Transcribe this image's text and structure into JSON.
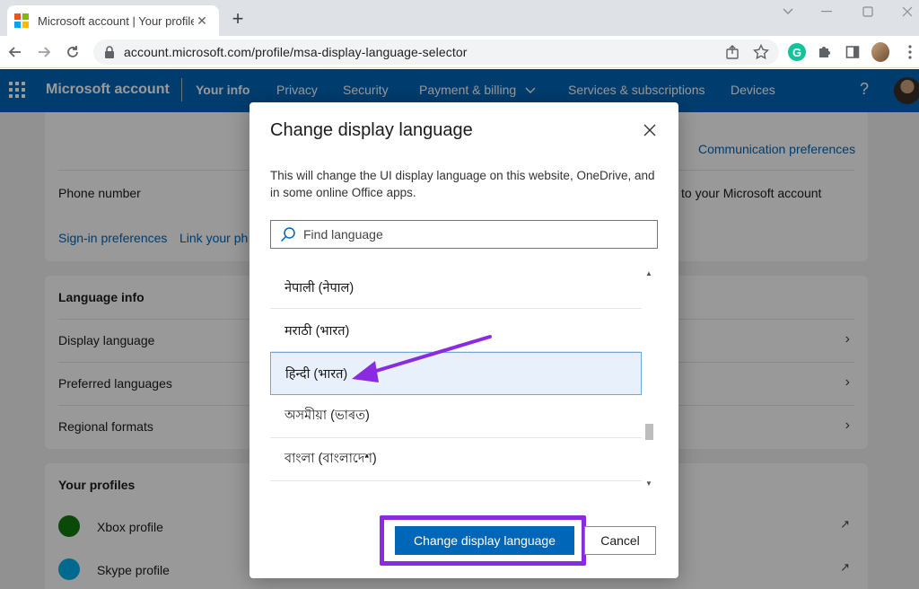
{
  "browser": {
    "tab_title": "Microsoft account | Your profile",
    "url": "account.microsoft.com/profile/msa-display-language-selector"
  },
  "msnav": {
    "brand": "Microsoft account",
    "links": [
      "Your info",
      "Privacy",
      "Security",
      "Payment & billing",
      "Services & subscriptions",
      "Devices"
    ],
    "help": "?"
  },
  "page": {
    "communication_preferences": "Communication preferences",
    "phone_number": "Phone number",
    "phone_hint": "to your Microsoft account",
    "signin_preferences": "Sign-in preferences",
    "link_phone": "Link your ph",
    "language_info": {
      "title": "Language info",
      "rows": [
        "Display language",
        "Preferred languages",
        "Regional formats"
      ]
    },
    "profiles": {
      "title": "Your profiles",
      "rows": [
        "Xbox profile",
        "Skype profile"
      ]
    }
  },
  "dialog": {
    "title": "Change display language",
    "description": "This will change the UI display language on this website, OneDrive, and in some online Office apps.",
    "search_placeholder": "Find language",
    "languages": [
      "नेपाली (नेपाल)",
      "मराठी (भारत)",
      "हिन्दी (भारत)",
      "অসমীয়া (ভাৰত)",
      "বাংলা (বাংলাদেশ)"
    ],
    "selected_index": 2,
    "primary_button": "Change display language",
    "secondary_button": "Cancel"
  },
  "colors": {
    "brand_blue": "#0067b8",
    "annotation_purple": "#8a2be2"
  }
}
